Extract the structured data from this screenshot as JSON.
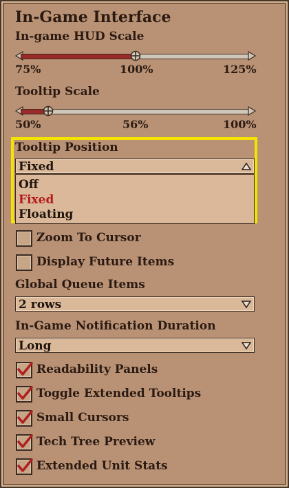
{
  "panel": {
    "title": "In-Game Interface",
    "hud_scale": {
      "label": "In-game HUD Scale",
      "ticks": [
        "75%",
        "100%",
        "125%"
      ],
      "value_fraction": 0.5
    },
    "tooltip_scale": {
      "label": "Tooltip Scale",
      "ticks": [
        "50%",
        "56%",
        "100%"
      ],
      "value_fraction": 0.12
    },
    "tooltip_position": {
      "label": "Tooltip Position",
      "selected": "Fixed",
      "options": [
        "Off",
        "Fixed",
        "Floating"
      ]
    },
    "checkboxes_top": [
      {
        "label": "Zoom To Cursor",
        "checked": false
      },
      {
        "label": "Display Future Items",
        "checked": false
      }
    ],
    "global_queue": {
      "label": "Global Queue Items",
      "selected": "2 rows"
    },
    "notification_duration": {
      "label": "In-Game Notification Duration",
      "selected": "Long"
    },
    "checkboxes_bottom": [
      {
        "label": "Readability Panels",
        "checked": true
      },
      {
        "label": "Toggle Extended Tooltips",
        "checked": true
      },
      {
        "label": "Small Cursors",
        "checked": true
      },
      {
        "label": "Tech Tree Preview",
        "checked": true
      },
      {
        "label": "Extended Unit Stats",
        "checked": true
      }
    ],
    "colors": {
      "accent_red": "#9a2a2a",
      "highlight": "#f5e400",
      "selected_option": "#b21e1e"
    }
  }
}
